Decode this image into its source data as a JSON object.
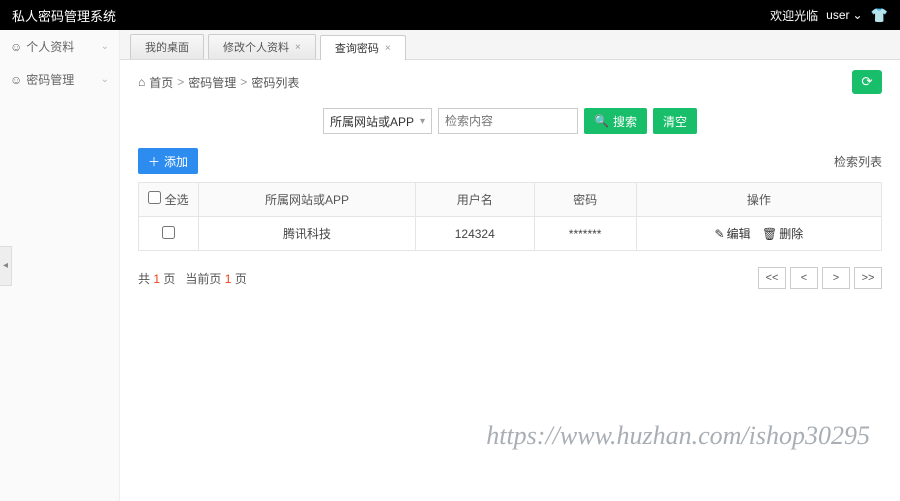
{
  "topbar": {
    "title": "私人密码管理系统",
    "welcome": "欢迎光临",
    "username": "user"
  },
  "sidebar": {
    "items": [
      {
        "label": "个人资料"
      },
      {
        "label": "密码管理"
      }
    ]
  },
  "tabs": [
    {
      "label": "我的桌面",
      "closable": false
    },
    {
      "label": "修改个人资料",
      "closable": true
    },
    {
      "label": "查询密码",
      "closable": true,
      "active": true
    }
  ],
  "breadcrumb": {
    "home": "首页",
    "seg1": "密码管理",
    "seg2": "密码列表"
  },
  "search": {
    "select_label": "所属网站或APP",
    "placeholder": "检索内容",
    "search_btn": "搜索",
    "clear_btn": "清空"
  },
  "list": {
    "add_btn": "添加",
    "title": "检索列表"
  },
  "table": {
    "headers": {
      "select_all": "全选",
      "site": "所属网站或APP",
      "user": "用户名",
      "pwd": "密码",
      "ops": "操作"
    },
    "rows": [
      {
        "site": "腾讯科技",
        "user": "124324",
        "pwd": "*******"
      }
    ],
    "ops": {
      "edit": "编辑",
      "delete": "删除"
    }
  },
  "pager": {
    "total_prefix": "共",
    "total_pages": "1",
    "total_suffix": "页",
    "current_prefix": "当前页",
    "current_page": "1",
    "current_suffix": "页",
    "first": "<<",
    "prev": "<",
    "next": ">",
    "last": ">>"
  },
  "watermark": "https://www.huzhan.com/ishop30295"
}
